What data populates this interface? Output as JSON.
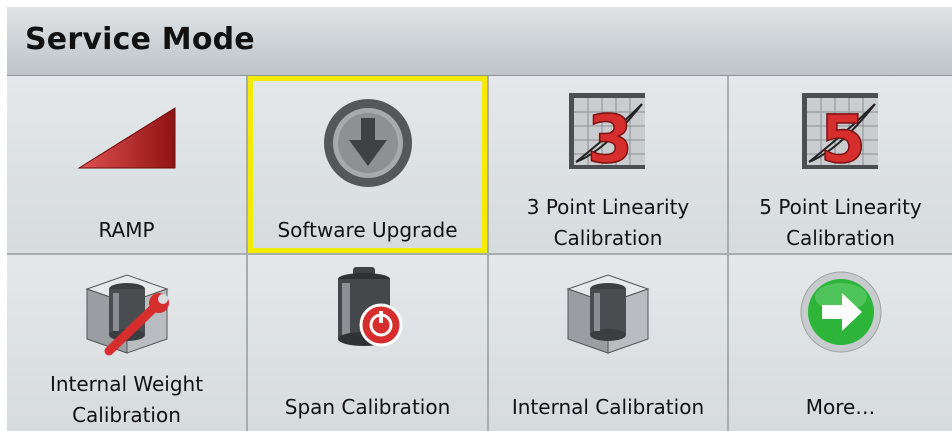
{
  "header": {
    "title": "Service Mode"
  },
  "tiles": [
    {
      "label": "RAMP",
      "icon": "ramp-icon"
    },
    {
      "label": "Software Upgrade",
      "icon": "download-arrow-icon",
      "selected": true
    },
    {
      "label_line1": "3 Point Linearity",
      "label_line2": "Calibration",
      "icon": "linearity-3-icon",
      "number": "3"
    },
    {
      "label_line1": "5 Point Linearity",
      "label_line2": "Calibration",
      "icon": "linearity-5-icon",
      "number": "5"
    },
    {
      "label_line1": "Internal Weight",
      "label_line2": "Calibration",
      "icon": "weight-wrench-icon"
    },
    {
      "label": "Span Calibration",
      "icon": "weight-power-icon"
    },
    {
      "label": "Internal Calibration",
      "icon": "internal-weight-icon"
    },
    {
      "label": "More…",
      "icon": "right-arrow-icon"
    }
  ],
  "colors": {
    "selection_highlight": "#f4ec00",
    "number_red": "#d62d2d",
    "more_arrow_green": "#2db53a"
  }
}
